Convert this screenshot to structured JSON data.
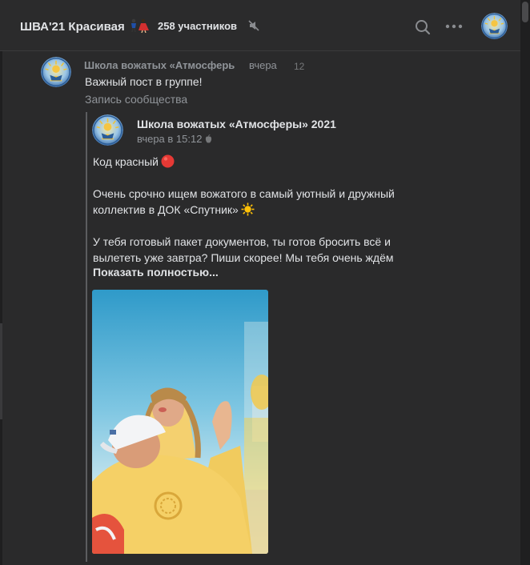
{
  "header": {
    "chat_title": "ШВА'21 Красивая",
    "members": "258 участников",
    "icons": [
      "dancers-emoji",
      "mute-icon",
      "search-icon",
      "more-icon",
      "avatar"
    ]
  },
  "message": {
    "sender": "Школа вожатых «Атмосферь",
    "time": "вчера",
    "views": "12",
    "text": "Важный пост в группе!",
    "attachment_label": "Запись сообщества"
  },
  "post": {
    "author": "Школа вожатых «Атмосферы» 2021",
    "time": "вчера в 15:12",
    "line1": "Код красный",
    "line2": "Очень срочно ищем вожатого в самый уютный и дружный коллектив в ДОК «Спутник»",
    "line3": "У тебя готовый пакет документов, ты готов бросить всё и вылететь уже завтра? Пиши скорее! Мы тебя очень ждём",
    "show_more": "Показать полностью..."
  },
  "colors": {
    "background": "#2a2a2b",
    "text": "#e1e3e6",
    "secondary_text": "#909499",
    "accent_red": "#e53935",
    "sun": "#ffc107"
  }
}
